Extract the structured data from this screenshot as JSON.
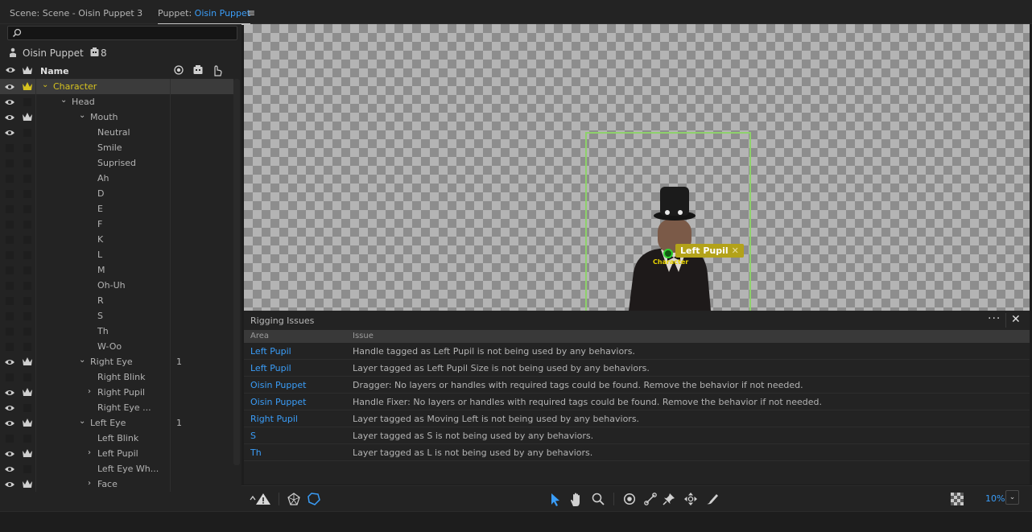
{
  "tabs": {
    "scene_label": "Scene: Scene - Oisin Puppet 3",
    "puppet_prefix": "Puppet: ",
    "puppet_name": "Oisin Puppet"
  },
  "puppet": {
    "name": "Oisin Puppet",
    "count": "8"
  },
  "columns": {
    "name": "Name"
  },
  "layers": [
    {
      "name": "Character",
      "indent": 0,
      "chev": "v",
      "eye": true,
      "crown": true,
      "selected": true,
      "num": ""
    },
    {
      "name": "Head",
      "indent": 1,
      "chev": "v",
      "eye": true,
      "crown": false,
      "num": ""
    },
    {
      "name": "Mouth",
      "indent": 2,
      "chev": "v",
      "eye": true,
      "crown": true,
      "num": ""
    },
    {
      "name": "Neutral",
      "indent": 3,
      "chev": "",
      "eye": true,
      "crown": false,
      "num": ""
    },
    {
      "name": "Smile",
      "indent": 3,
      "chev": "",
      "eye": false,
      "crown": false,
      "num": ""
    },
    {
      "name": "Suprised",
      "indent": 3,
      "chev": "",
      "eye": false,
      "crown": false,
      "num": ""
    },
    {
      "name": "Ah",
      "indent": 3,
      "chev": "",
      "eye": false,
      "crown": false,
      "num": ""
    },
    {
      "name": "D",
      "indent": 3,
      "chev": "",
      "eye": false,
      "crown": false,
      "num": ""
    },
    {
      "name": "E",
      "indent": 3,
      "chev": "",
      "eye": false,
      "crown": false,
      "num": ""
    },
    {
      "name": "F",
      "indent": 3,
      "chev": "",
      "eye": false,
      "crown": false,
      "num": ""
    },
    {
      "name": "K",
      "indent": 3,
      "chev": "",
      "eye": false,
      "crown": false,
      "num": ""
    },
    {
      "name": "L",
      "indent": 3,
      "chev": "",
      "eye": false,
      "crown": false,
      "num": ""
    },
    {
      "name": "M",
      "indent": 3,
      "chev": "",
      "eye": false,
      "crown": false,
      "num": ""
    },
    {
      "name": "Oh-Uh",
      "indent": 3,
      "chev": "",
      "eye": false,
      "crown": false,
      "num": ""
    },
    {
      "name": "R",
      "indent": 3,
      "chev": "",
      "eye": false,
      "crown": false,
      "num": ""
    },
    {
      "name": "S",
      "indent": 3,
      "chev": "",
      "eye": false,
      "crown": false,
      "num": ""
    },
    {
      "name": "Th",
      "indent": 3,
      "chev": "",
      "eye": false,
      "crown": false,
      "num": ""
    },
    {
      "name": "W-Oo",
      "indent": 3,
      "chev": "",
      "eye": false,
      "crown": false,
      "num": ""
    },
    {
      "name": "Right Eye",
      "indent": 2,
      "chev": "v",
      "eye": true,
      "crown": true,
      "num": "1"
    },
    {
      "name": "Right Blink",
      "indent": 3,
      "chev": "",
      "eye": false,
      "crown": false,
      "num": ""
    },
    {
      "name": "Right Pupil",
      "indent": 3,
      "chev": ">",
      "eye": true,
      "crown": true,
      "num": ""
    },
    {
      "name": "Right Eye ...",
      "indent": 3,
      "chev": "",
      "eye": true,
      "crown": false,
      "num": ""
    },
    {
      "name": "Left Eye",
      "indent": 2,
      "chev": "v",
      "eye": true,
      "crown": true,
      "num": "1"
    },
    {
      "name": "Left Blink",
      "indent": 3,
      "chev": "",
      "eye": false,
      "crown": false,
      "num": ""
    },
    {
      "name": "Left Pupil",
      "indent": 3,
      "chev": ">",
      "eye": true,
      "crown": true,
      "num": ""
    },
    {
      "name": "Left Eye Wh...",
      "indent": 3,
      "chev": "",
      "eye": true,
      "crown": false,
      "num": ""
    },
    {
      "name": "Face",
      "indent": 3,
      "chev": ">",
      "eye": true,
      "crown": true,
      "num": ""
    }
  ],
  "canvas": {
    "tag_label": "Left Pupil",
    "tag_close": "✕",
    "origin_label": "Character"
  },
  "issues": {
    "title": "Rigging Issues",
    "more": "···",
    "close": "✕",
    "col_area": "Area",
    "col_issue": "Issue",
    "rows": [
      {
        "area": "Left Pupil",
        "issue": "Handle tagged as Left Pupil is not being used by any behaviors."
      },
      {
        "area": "Left Pupil",
        "issue": "Layer tagged as Left Pupil Size is not being used by any behaviors."
      },
      {
        "area": "Oisin Puppet",
        "issue": "Dragger: No layers or handles with required tags could be found. Remove the behavior if not needed."
      },
      {
        "area": "Oisin Puppet",
        "issue": "Handle Fixer: No layers or handles with required tags could be found. Remove the behavior if not needed."
      },
      {
        "area": "Right Pupil",
        "issue": "Layer tagged as Moving Left is not being used by any behaviors."
      },
      {
        "area": "S",
        "issue": "Layer tagged as S is not being used by any behaviors."
      },
      {
        "area": "Th",
        "issue": "Layer tagged as L is not being used by any behaviors."
      }
    ]
  },
  "toolbar": {
    "zoom": "10%",
    "zoom_dropdown": "⌄"
  },
  "colors": {
    "accent": "#3a9df8",
    "selected_text": "#d6c21f",
    "frame": "#8ed16b",
    "tag_bg": "#b3a219"
  }
}
